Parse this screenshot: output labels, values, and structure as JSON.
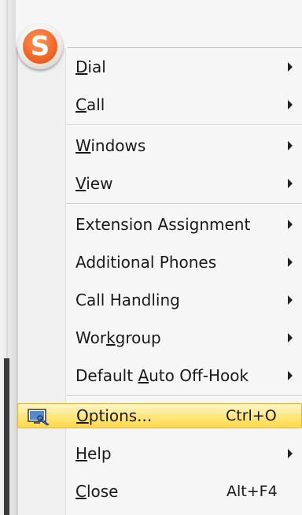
{
  "menu": {
    "group1": [
      {
        "pre": "",
        "key": "D",
        "post": "ial",
        "submenu": true
      },
      {
        "pre": "",
        "key": "C",
        "post": "all",
        "submenu": true
      }
    ],
    "group2": [
      {
        "pre": "",
        "key": "W",
        "post": "indows",
        "submenu": true
      },
      {
        "pre": "",
        "key": "V",
        "post": "iew",
        "submenu": true
      }
    ],
    "group3": [
      {
        "label": "Extension Assignment",
        "submenu": true
      },
      {
        "label": "Additional Phones",
        "submenu": true
      },
      {
        "label": "Call Handling",
        "submenu": true
      },
      {
        "pre": "Wor",
        "key": "k",
        "post": "group",
        "submenu": true
      },
      {
        "pre": "Default ",
        "key": "A",
        "post": "uto Off-Hook",
        "submenu": true
      }
    ],
    "options": {
      "pre": "",
      "key": "O",
      "post": "ptions...",
      "shortcut": "Ctrl+O",
      "icon": "options-icon"
    },
    "help": {
      "pre": "",
      "key": "H",
      "post": "elp",
      "submenu": true
    },
    "close": {
      "pre": "",
      "key": "C",
      "post": "lose",
      "shortcut": "Alt+F4"
    }
  },
  "colors": {
    "highlight": "#ffe57a",
    "highlight_border": "#e5b43d",
    "logo_orange": "#f26a2a"
  }
}
